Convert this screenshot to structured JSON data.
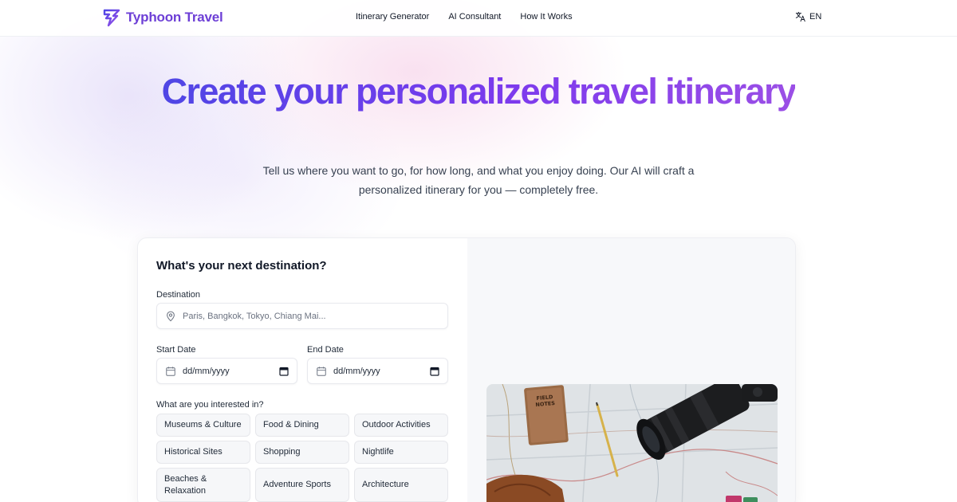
{
  "brand": {
    "name": "Typhoon Travel",
    "accent": "#6d3fd6"
  },
  "nav": {
    "links": [
      {
        "label": "Itinerary Generator"
      },
      {
        "label": "AI Consultant"
      },
      {
        "label": "How It Works"
      }
    ],
    "language": {
      "icon": "translate-icon",
      "label": "EN"
    }
  },
  "hero": {
    "title": "Create your personalized travel itinerary",
    "subtitle": "Tell us where you want to go, for how long, and what you enjoy doing. Our AI will craft a personalized itinerary for you — completely free.",
    "gradient": [
      "#4f46e5",
      "#9b4fe6"
    ]
  },
  "form": {
    "title": "What's your next destination?",
    "destination": {
      "label": "Destination",
      "icon": "map-pin-icon",
      "placeholder": "Paris, Bangkok, Tokyo, Chiang Mai..."
    },
    "start_date": {
      "label": "Start Date",
      "value": "dd/mm/yyyy",
      "icon": "calendar-icon"
    },
    "end_date": {
      "label": "End Date",
      "value": "dd/mm/yyyy",
      "icon": "calendar-icon"
    },
    "interests": {
      "label": "What are you interested in?",
      "options": [
        "Museums & Culture",
        "Food & Dining",
        "Outdoor Activities",
        "Historical Sites",
        "Shopping",
        "Nightlife",
        "Beaches & Relaxation",
        "Adventure Sports",
        "Architecture"
      ]
    }
  }
}
